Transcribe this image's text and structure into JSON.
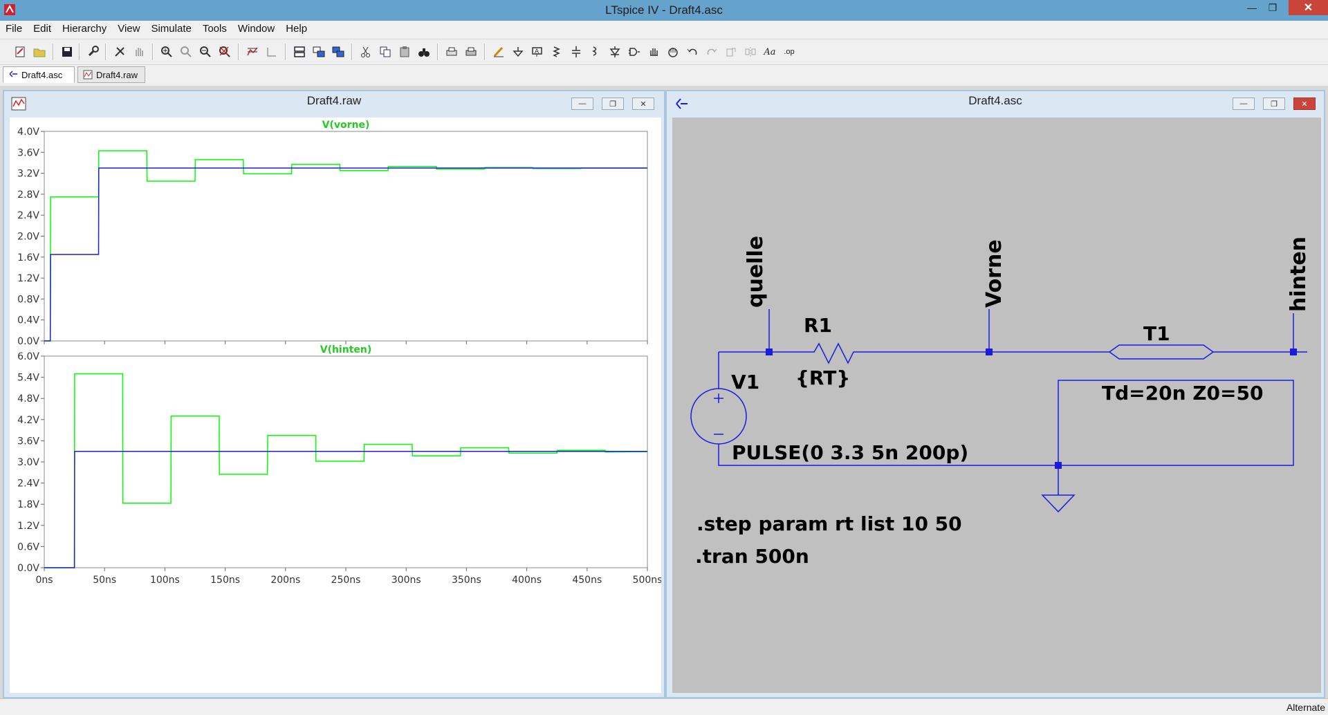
{
  "window": {
    "title": "LTspice IV - Draft4.asc"
  },
  "menu": [
    "File",
    "Edit",
    "Hierarchy",
    "View",
    "Simulate",
    "Tools",
    "Window",
    "Help"
  ],
  "tabs": [
    {
      "label": "Draft4.asc",
      "icon": "schematic-icon",
      "active": true
    },
    {
      "label": "Draft4.raw",
      "icon": "waveform-icon",
      "active": false
    }
  ],
  "waveform_window": {
    "title": "Draft4.raw"
  },
  "schematic_window": {
    "title": "Draft4.asc"
  },
  "colors": {
    "trace_step1": "#00ff00",
    "trace_step2": "#1f1fd0",
    "schematic_wire": "#1a1ae0",
    "schematic_bg": "#c0c0c0",
    "plot_title": "#22cc22"
  },
  "chart_data": [
    {
      "type": "line",
      "title": "V(vorne)",
      "xlim": [
        0,
        500
      ],
      "ylim": [
        0,
        4.0
      ],
      "x_ticks": [
        "0ns",
        "50ns",
        "100ns",
        "150ns",
        "200ns",
        "250ns",
        "300ns",
        "350ns",
        "400ns",
        "450ns",
        "500ns"
      ],
      "y_ticks": [
        "0.0V",
        "0.4V",
        "0.8V",
        "1.2V",
        "1.6V",
        "2.0V",
        "2.4V",
        "2.8V",
        "3.2V",
        "3.6V",
        "4.0V"
      ],
      "series": [
        {
          "points": [
            [
              0,
              0
            ],
            [
              5,
              0
            ],
            [
              5.2,
              2.75
            ],
            [
              45,
              2.75
            ],
            [
              45.2,
              3.63
            ],
            [
              85,
              3.63
            ],
            [
              85.2,
              3.05
            ],
            [
              125,
              3.05
            ],
            [
              125.2,
              3.46
            ],
            [
              165,
              3.46
            ],
            [
              165.2,
              3.19
            ],
            [
              205,
              3.19
            ],
            [
              205.2,
              3.37
            ],
            [
              245,
              3.37
            ],
            [
              245.2,
              3.25
            ],
            [
              285,
              3.25
            ],
            [
              285.2,
              3.33
            ],
            [
              325,
              3.33
            ],
            [
              325.2,
              3.28
            ],
            [
              365,
              3.28
            ],
            [
              365.2,
              3.31
            ],
            [
              405,
              3.31
            ],
            [
              405.2,
              3.29
            ],
            [
              445,
              3.29
            ],
            [
              445.2,
              3.3
            ],
            [
              500,
              3.3
            ]
          ]
        },
        {
          "points": [
            [
              0,
              0
            ],
            [
              5,
              0
            ],
            [
              5.2,
              1.65
            ],
            [
              45,
              1.65
            ],
            [
              45.2,
              3.3
            ],
            [
              500,
              3.3
            ]
          ]
        }
      ]
    },
    {
      "type": "line",
      "title": "V(hinten)",
      "xlim": [
        0,
        500
      ],
      "ylim": [
        0,
        6.0
      ],
      "x_ticks": [
        "0ns",
        "50ns",
        "100ns",
        "150ns",
        "200ns",
        "250ns",
        "300ns",
        "350ns",
        "400ns",
        "450ns",
        "500ns"
      ],
      "y_ticks": [
        "0.0V",
        "0.6V",
        "1.2V",
        "1.8V",
        "2.4V",
        "3.0V",
        "3.6V",
        "4.2V",
        "4.8V",
        "5.4V",
        "6.0V"
      ],
      "series": [
        {
          "points": [
            [
              0,
              0
            ],
            [
              25,
              0
            ],
            [
              25.2,
              5.5
            ],
            [
              65,
              5.5
            ],
            [
              65.2,
              1.83
            ],
            [
              105,
              1.83
            ],
            [
              105.2,
              4.3
            ],
            [
              145,
              4.3
            ],
            [
              145.2,
              2.65
            ],
            [
              185,
              2.65
            ],
            [
              185.2,
              3.75
            ],
            [
              225,
              3.75
            ],
            [
              225.2,
              3.02
            ],
            [
              265,
              3.02
            ],
            [
              265.2,
              3.5
            ],
            [
              305,
              3.5
            ],
            [
              305.2,
              3.17
            ],
            [
              345,
              3.17
            ],
            [
              345.2,
              3.4
            ],
            [
              385,
              3.4
            ],
            [
              385.2,
              3.25
            ],
            [
              425,
              3.25
            ],
            [
              425.2,
              3.33
            ],
            [
              465,
              3.33
            ],
            [
              465.2,
              3.28
            ],
            [
              500,
              3.29
            ]
          ]
        },
        {
          "points": [
            [
              0,
              0
            ],
            [
              25,
              0
            ],
            [
              25.2,
              3.3
            ],
            [
              500,
              3.3
            ]
          ]
        }
      ]
    }
  ],
  "schematic": {
    "labels": {
      "net_quelle": "quelle",
      "net_vorne": "Vorne",
      "net_hinten": "hinten",
      "r1_name": "R1",
      "r1_value": "{RT}",
      "v1_name": "V1",
      "v1_value": "PULSE(0 3.3 5n 200p)",
      "t1_name": "T1",
      "t1_value": "Td=20n Z0=50",
      "directive_step": ".step param rt list 10 50",
      "directive_tran": ".tran 500n"
    }
  },
  "status": {
    "text": "Alternate"
  }
}
